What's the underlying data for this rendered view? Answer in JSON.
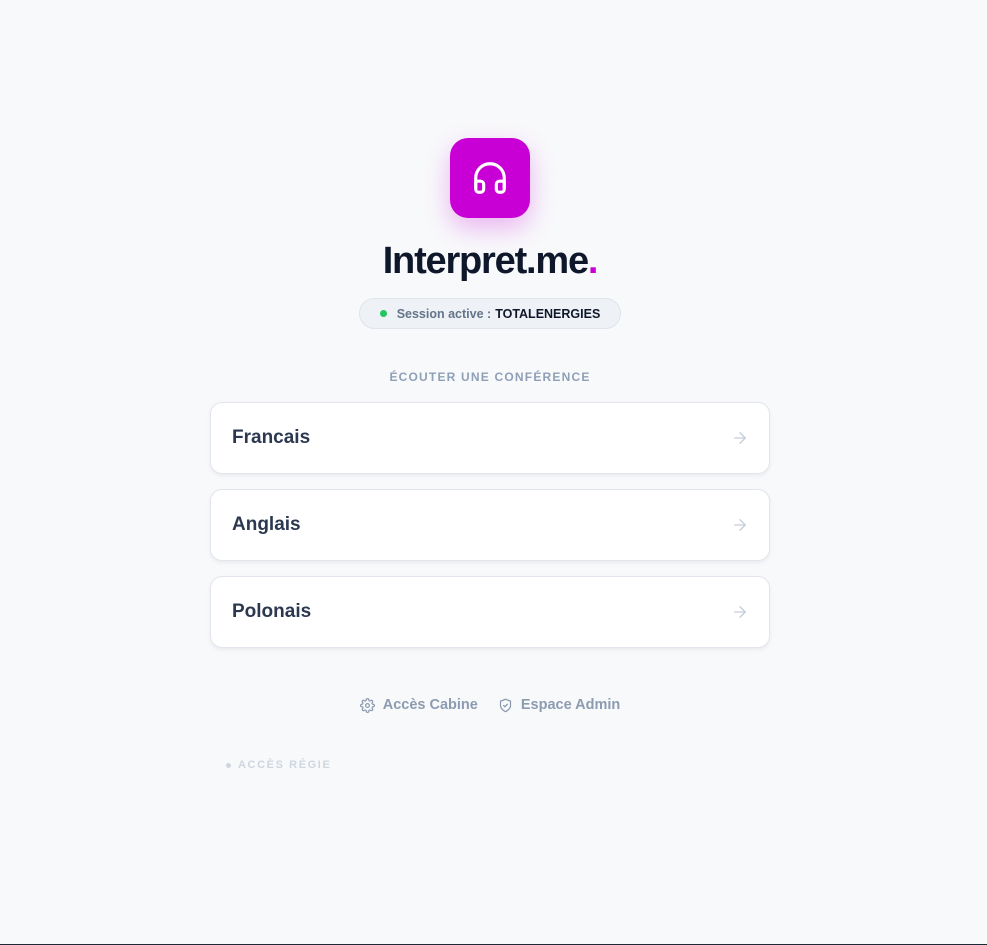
{
  "brand": {
    "name": "Interpret.me",
    "dot": ".",
    "accent": "#c800d6"
  },
  "session": {
    "label": "Session active :",
    "name": "TOTALENERGIES",
    "status_color": "#22c55e"
  },
  "section_title": "ÉCOUTER UNE CONFÉRENCE",
  "languages": [
    {
      "label": "Francais"
    },
    {
      "label": "Anglais"
    },
    {
      "label": "Polonais"
    }
  ],
  "footer": {
    "cabine": "Accès Cabine",
    "admin": "Espace Admin"
  },
  "regie": "ACCÈS RÉGIE",
  "icons": {
    "logo": "headphones-icon",
    "cabine": "gear-icon",
    "admin": "shield-icon",
    "arrow": "arrow-right-icon"
  }
}
